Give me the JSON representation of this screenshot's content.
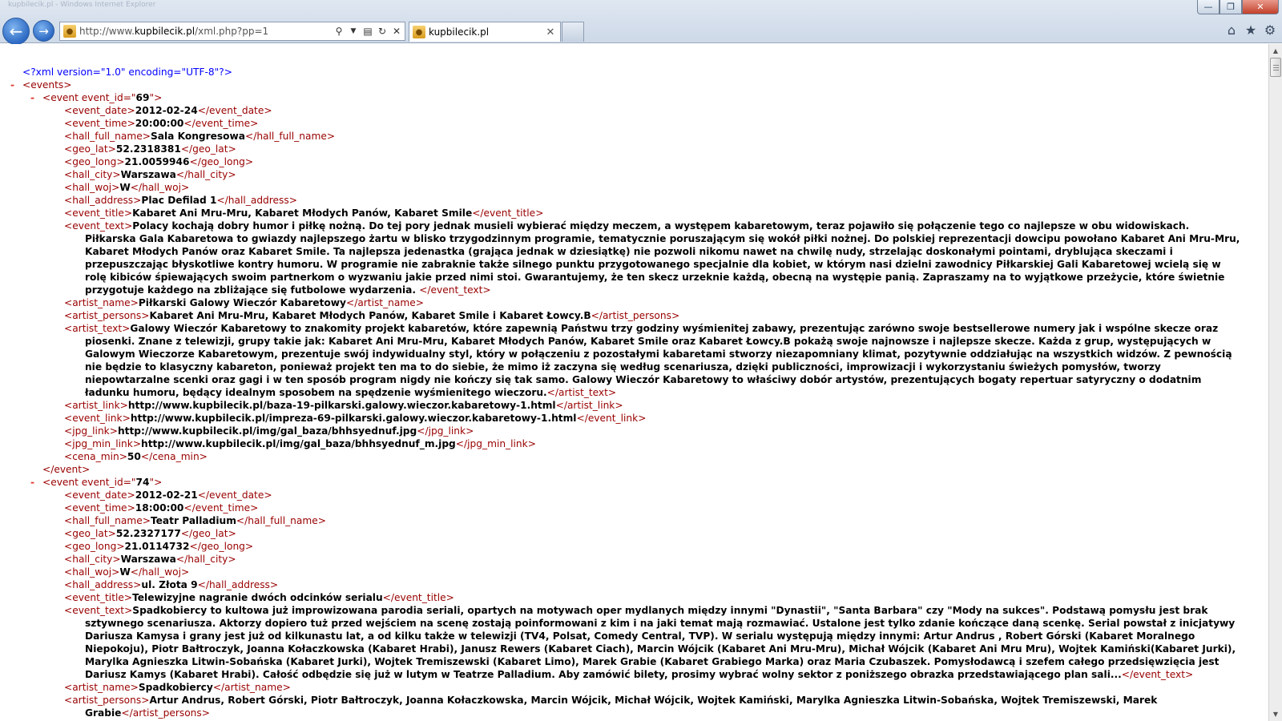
{
  "browser": {
    "titlebar_hint": "kupbilecik.pl - Windows Internet Explorer",
    "window_controls": {
      "min": "—",
      "max": "❐",
      "close": "✕"
    },
    "address": {
      "prefix": "http://www.",
      "domain": "kupbilecik.pl",
      "path": "/xml.php?pp=1"
    },
    "tab_label": "kupbilecik.pl",
    "icons": [
      "home-icon",
      "favorites-star-icon",
      "tools-gear-icon",
      "search-icon",
      "compat-view-icon",
      "refresh-icon",
      "stop-icon"
    ]
  },
  "xml": {
    "declaration": "<?xml version=\"1.0\" encoding=\"UTF-8\"?>",
    "events": [
      {
        "event_id": "69",
        "fields": [
          {
            "tag": "event_date",
            "value": "2012-02-24"
          },
          {
            "tag": "event_time",
            "value": "20:00:00"
          },
          {
            "tag": "hall_full_name",
            "value": "Sala Kongresowa"
          },
          {
            "tag": "geo_lat",
            "value": "52.2318381"
          },
          {
            "tag": "geo_long",
            "value": "21.0059946"
          },
          {
            "tag": "hall_city",
            "value": "Warszawa"
          },
          {
            "tag": "hall_woj",
            "value": "W"
          },
          {
            "tag": "hall_address",
            "value": "Plac Defilad 1"
          },
          {
            "tag": "event_title",
            "value": "Kabaret Ani Mru-Mru, Kabaret Młodych Panów, Kabaret Smile"
          },
          {
            "tag": "event_text",
            "value": "Polacy kochają dobry humor i piłkę nożną. Do tej pory jednak musieli wybierać między meczem, a występem kabaretowym, teraz pojawiło się połączenie tego co najlepsze w obu widowiskach. Piłkarska Gala Kabaretowa to gwiazdy najlepszego żartu w blisko trzygodzinnym programie, tematycznie poruszającym się wokół piłki nożnej. Do polskiej reprezentacji dowcipu powołano Kabaret Ani Mru-Mru, Kabaret Młodych Panów oraz Kabaret Smile. Ta najlepsza jedenastka (grająca jednak w dziesiątkę) nie pozwoli nikomu nawet na chwilę nudy, strzelając doskonałymi pointami, dryblująca skeczami i przepuszczając błyskotliwe kontry humoru. W programie nie zabraknie także silnego punktu przygotowanego specjalnie dla kobiet, w którym nasi dzielni zawodnicy Piłkarskiej Gali Kabaretowej wcielą się w rolę kibiców śpiewających swoim partnerkom o wyzwaniu jakie przed nimi stoi. Gwarantujemy, że ten skecz urzeknie każdą, obecną na występie panią. Zapraszamy na to wyjątkowe przeżycie, które świetnie przygotuje każdego na zbliżające się futbolowe wydarzenia. "
          },
          {
            "tag": "artist_name",
            "value": "Piłkarski Galowy Wieczór Kabaretowy"
          },
          {
            "tag": "artist_persons",
            "value": "Kabaret Ani Mru-Mru, Kabaret Młodych Panów, Kabaret Smile i Kabaret Łowcy.B"
          },
          {
            "tag": "artist_text",
            "value": "Galowy Wieczór Kabaretowy to znakomity projekt kabaretów, które zapewnią Państwu trzy godziny wyśmienitej zabawy, prezentując zarówno swoje bestsellerowe numery jak i wspólne skecze oraz piosenki. Znane z telewizji, grupy takie jak: Kabaret Ani Mru-Mru, Kabaret Młodych Panów, Kabaret Smile oraz Kabaret Łowcy.B pokażą swoje najnowsze i najlepsze skecze. Każda z grup, występujących w Galowym Wieczorze Kabaretowym, prezentuje swój indywidualny styl, który w połączeniu z pozostałymi kabaretami stworzy niezapomniany klimat, pozytywnie oddziałując na wszystkich widzów. Z pewnością nie będzie to klasyczny kabareton, ponieważ projekt ten ma to do siebie, że mimo iż zaczyna się według scenariusza, dzięki publiczności, improwizacji i wykorzystaniu świeżych pomysłów, tworzy niepowtarzalne scenki oraz gagi i w ten sposób program nigdy nie kończy się tak samo. Galowy Wieczór Kabaretowy to właściwy dobór artystów, prezentujących bogaty repertuar satyryczny o dodatnim ładunku humoru, będący idealnym sposobem na spędzenie wyśmienitego wieczoru."
          },
          {
            "tag": "artist_link",
            "value": "http://www.kupbilecik.pl/baza-19-pilkarski.galowy.wieczor.kabaretowy-1.html"
          },
          {
            "tag": "event_link",
            "value": "http://www.kupbilecik.pl/impreza-69-pilkarski.galowy.wieczor.kabaretowy-1.html"
          },
          {
            "tag": "jpg_link",
            "value": "http://www.kupbilecik.pl/img/gal_baza/bhhsyednuf.jpg"
          },
          {
            "tag": "jpg_min_link",
            "value": "http://www.kupbilecik.pl/img/gal_baza/bhhsyednuf_m.jpg"
          },
          {
            "tag": "cena_min",
            "value": "50"
          }
        ]
      },
      {
        "event_id": "74",
        "fields": [
          {
            "tag": "event_date",
            "value": "2012-02-21"
          },
          {
            "tag": "event_time",
            "value": "18:00:00"
          },
          {
            "tag": "hall_full_name",
            "value": "Teatr Palladium"
          },
          {
            "tag": "geo_lat",
            "value": "52.2327177"
          },
          {
            "tag": "geo_long",
            "value": "21.0114732"
          },
          {
            "tag": "hall_city",
            "value": "Warszawa"
          },
          {
            "tag": "hall_woj",
            "value": "W"
          },
          {
            "tag": "hall_address",
            "value": "ul. Złota 9"
          },
          {
            "tag": "event_title",
            "value": "Telewizyjne nagranie dwóch odcinków serialu"
          },
          {
            "tag": "event_text",
            "value": "Spadkobiercy to kultowa już improwizowana parodia seriali, opartych na motywach oper mydlanych między innymi \"Dynastii\", \"Santa Barbara\" czy \"Mody na sukces\". Podstawą pomysłu jest brak sztywnego scenariusza. Aktorzy dopiero tuż przed wejściem na scenę zostają poinformowani z kim i na jaki temat mają rozmawiać. Ustalone jest tylko zdanie kończące daną scenkę. Serial powstał z inicjatywy Dariusza Kamysa i grany jest już od kilkunastu lat, a od kilku także w telewizji (TV4, Polsat, Comedy Central, TVP). W serialu występują między innymi: Artur Andrus , Robert Górski (Kabaret Moralnego Niepokoju), Piotr Bałtroczyk, Joanna Kołaczkowska (Kabaret Hrabi), Janusz Rewers (Kabaret Ciach), Marcin Wójcik (Kabaret Ani Mru-Mru), Michał Wójcik (Kabaret Ani Mru Mru), Wojtek Kamiński(Kabaret Jurki), Marylka Agnieszka Litwin-Sobańska (Kabaret Jurki), Wojtek Tremiszewski (Kabaret Limo), Marek Grabie (Kabaret Grabiego Marka) oraz Maria Czubaszek. Pomysłodawcą i szefem całego przedsięwzięcia jest Dariusz Kamys (Kabaret Hrabi). Całość odbędzie się już w lutym w Teatrze Palladium. Aby zamówić bilety, prosimy wybrać wolny sektor z poniższego obrazka przedstawiającego plan sali..."
          },
          {
            "tag": "artist_name",
            "value": "Spadkobiercy"
          },
          {
            "tag": "artist_persons",
            "value": "Artur Andrus, Robert Górski, Piotr Bałtroczyk, Joanna Kołaczkowska, Marcin Wójcik, Michał Wójcik, Wojtek Kamiński, Marylka Agnieszka Litwin-Sobańska, Wojtek Tremiszewski, Marek Grabie"
          }
        ]
      }
    ]
  }
}
